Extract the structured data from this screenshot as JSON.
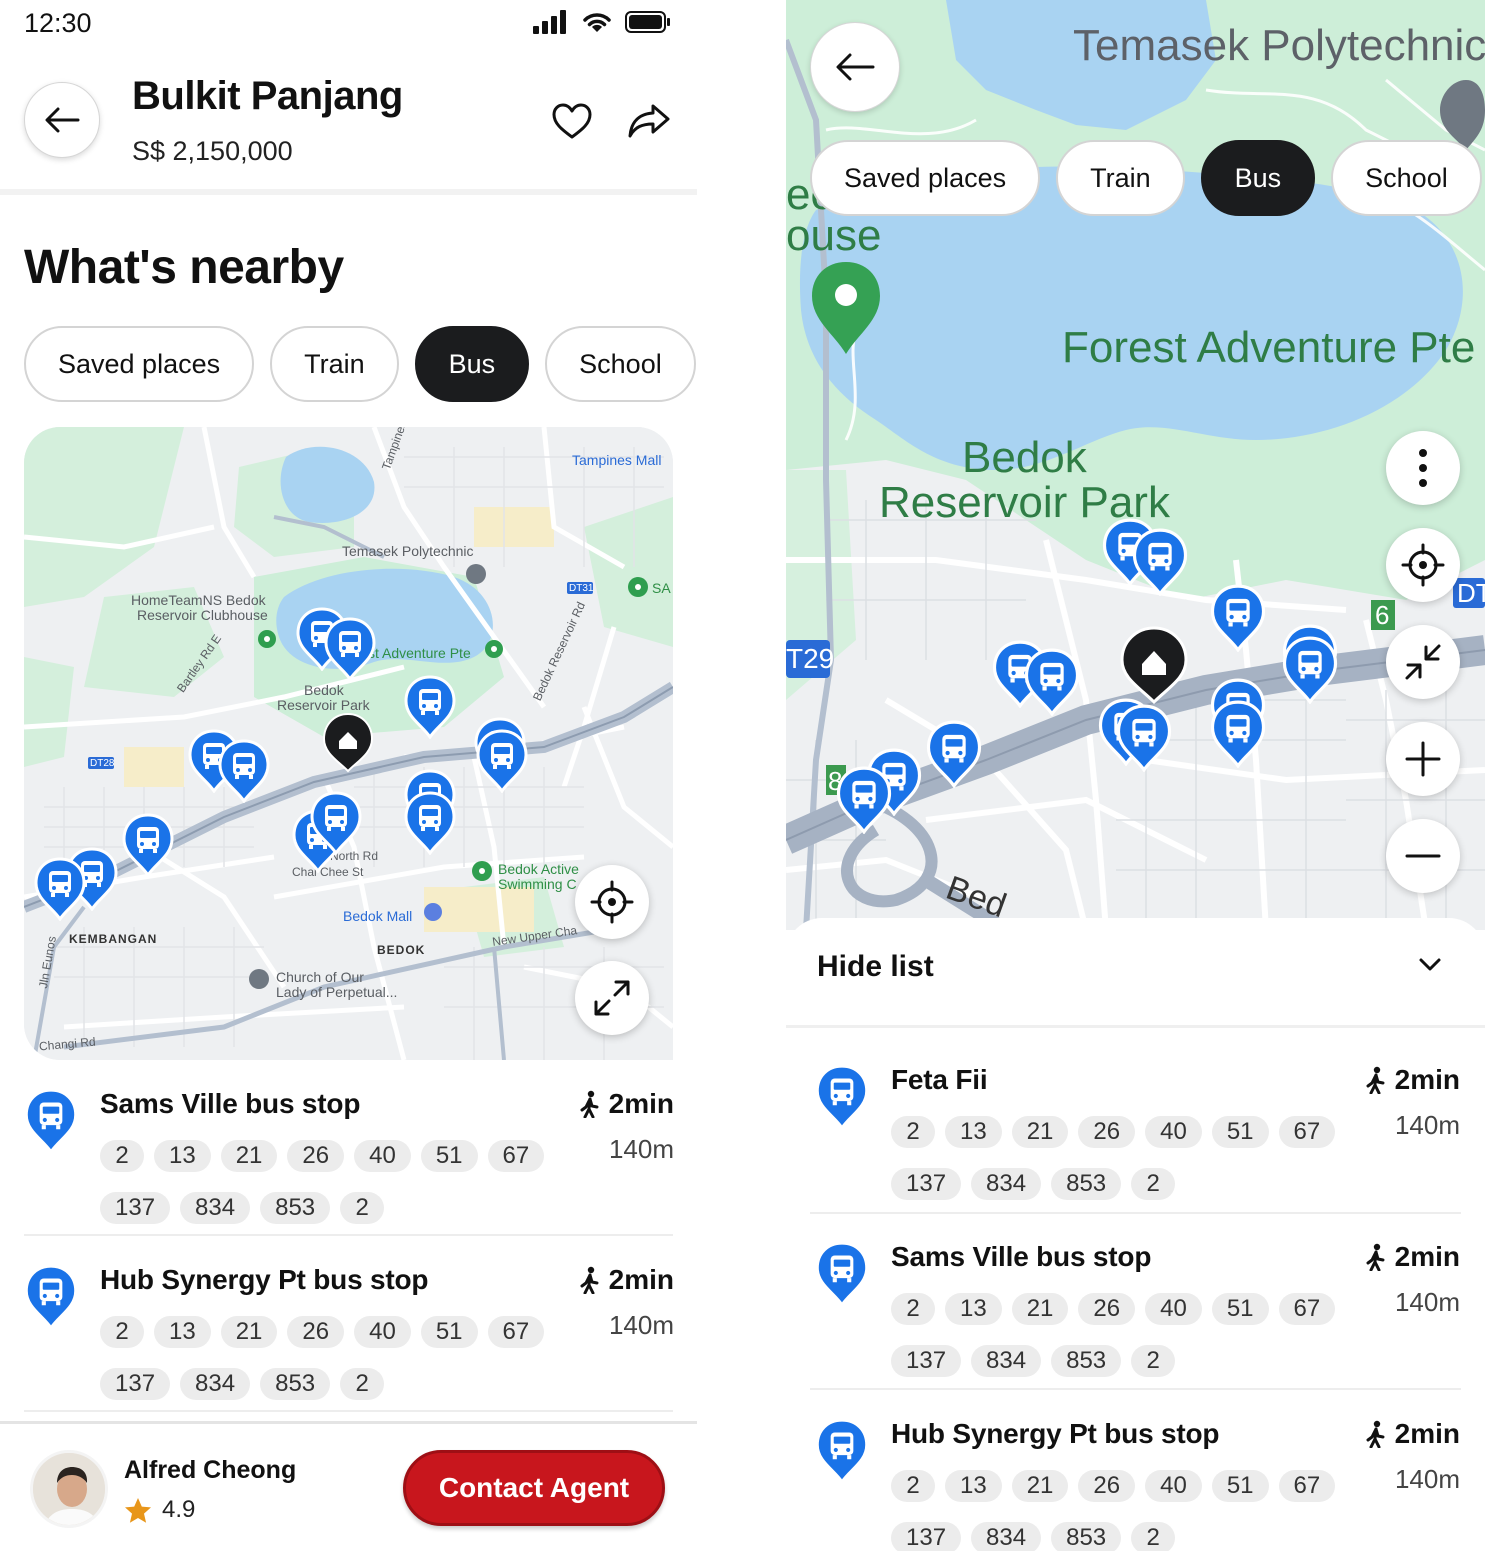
{
  "status": {
    "time": "12:30"
  },
  "listing": {
    "title": "Bulkit Panjang",
    "price": "S$ 2,150,000"
  },
  "section_title": "What's nearby",
  "chips": [
    "Saved places",
    "Train",
    "Bus",
    "School"
  ],
  "active_chip": "Bus",
  "map_left": {
    "labels": {
      "tampines_mall": "Tampines Mall",
      "tampines_ave": "Tampines Ave",
      "temasek_poly": "Temasek Polytechnic",
      "hometeam": "HomeTeamNS Bedok",
      "hometeam2": "Reservoir Clubhouse",
      "forest": "st Adventure Pte",
      "bedok_res": "Bedok",
      "bedok_res2": "Reservoir Park",
      "bartley": "Bartley Rd E",
      "bedok_res_rd": "Bedok Reservoir Rd",
      "dt31": "DT31",
      "dt28": "DT28",
      "sa": "SA",
      "north_rd": "North Rd",
      "chai_chee": "Chai Chee St",
      "bedok_active": "Bedok Active",
      "swimming": "Swimming C",
      "bedok_mall": "Bedok Mall",
      "kembangan": "KEMBANGAN",
      "bedok": "BEDOK",
      "new_upper": "New Upper Cha",
      "church": "Church of Our",
      "church2": "Lady of Perpetual...",
      "changi": "Changi Rd",
      "jln_eunos": "Jln Eunos"
    }
  },
  "map_right": {
    "labels": {
      "temasek": "Temasek Polytechnic",
      "ec": "ec",
      "ouse": "ouse",
      "forest": "Forest Adventure Pte",
      "bedok": "Bedok",
      "reservoir_park": "Reservoir Park",
      "t29": "T29",
      "dt": "DT",
      "six": "6",
      "eight": "8",
      "bed": "Bed"
    }
  },
  "bus_stops_left": [
    {
      "name": "Sams Ville bus stop",
      "time": "2min",
      "distance": "140m",
      "routes": [
        "2",
        "13",
        "21",
        "26",
        "40",
        "51",
        "67",
        "137",
        "834",
        "853",
        "2"
      ]
    },
    {
      "name": "Hub Synergy Pt bus stop",
      "time": "2min",
      "distance": "140m",
      "routes": [
        "2",
        "13",
        "21",
        "26",
        "40",
        "51",
        "67",
        "137",
        "834",
        "853",
        "2"
      ]
    }
  ],
  "bus_stops_right": [
    {
      "name": "Feta Fii",
      "time": "2min",
      "distance": "140m",
      "routes": [
        "2",
        "13",
        "21",
        "26",
        "40",
        "51",
        "67",
        "137",
        "834",
        "853",
        "2"
      ]
    },
    {
      "name": "Sams Ville bus stop",
      "time": "2min",
      "distance": "140m",
      "routes": [
        "2",
        "13",
        "21",
        "26",
        "40",
        "51",
        "67",
        "137",
        "834",
        "853",
        "2"
      ]
    },
    {
      "name": "Hub Synergy Pt bus stop",
      "time": "2min",
      "distance": "140m",
      "routes": [
        "2",
        "13",
        "21",
        "26",
        "40",
        "51",
        "67",
        "137",
        "834",
        "853",
        "2"
      ]
    }
  ],
  "sheet": {
    "hide_list": "Hide list"
  },
  "agent": {
    "name": "Alfred Cheong",
    "rating": "4.9",
    "contact_label": "Contact Agent"
  },
  "colors": {
    "brand_red": "#c8161d",
    "bus_blue": "#1a73e8",
    "chip_active": "#1b1c1e",
    "water": "#a9d3f2",
    "park": "#cdeed8"
  },
  "icons": [
    "back-arrow-icon",
    "heart-icon",
    "share-icon",
    "bus-icon",
    "walk-icon",
    "locate-icon",
    "expand-icon",
    "collapse-icon",
    "plus-icon",
    "minus-icon",
    "more-icon",
    "chevron-down-icon",
    "star-icon",
    "home-icon"
  ]
}
